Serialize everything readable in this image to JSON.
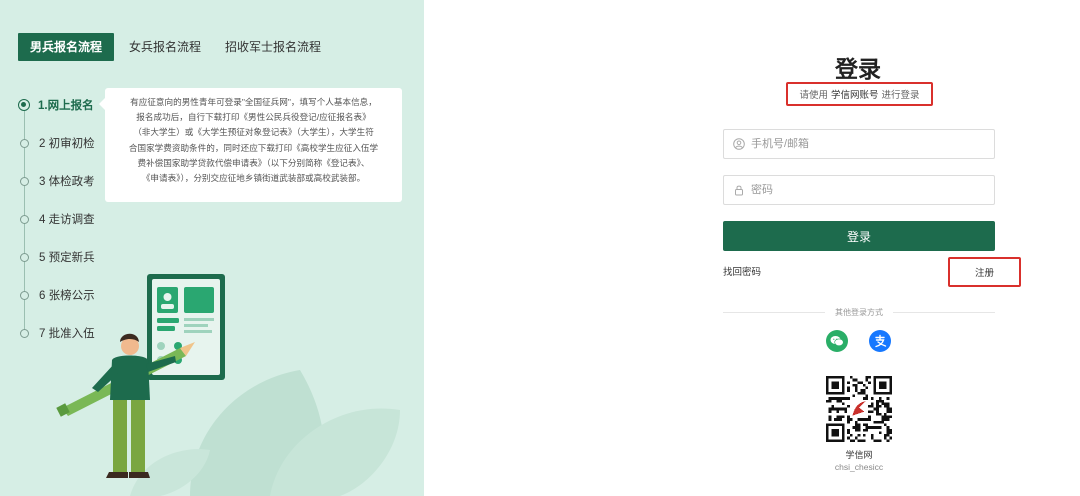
{
  "tabs": [
    {
      "label": "男兵报名流程",
      "active": true
    },
    {
      "label": "女兵报名流程",
      "active": false
    },
    {
      "label": "招收军士报名流程",
      "active": false
    }
  ],
  "steps": [
    {
      "label": "1.网上报名",
      "active": true
    },
    {
      "label": "2 初审初检",
      "active": false
    },
    {
      "label": "3 体检政考",
      "active": false
    },
    {
      "label": "4 走访调查",
      "active": false
    },
    {
      "label": "5 预定新兵",
      "active": false
    },
    {
      "label": "6 张榜公示",
      "active": false
    },
    {
      "label": "7 批准入伍",
      "active": false
    }
  ],
  "info": {
    "lines": [
      "有应征意向的男性青年可登录\"全国征兵网\"，填写个人基本信息，",
      "报名成功后，自行下载打印《男性公民兵役登记/应征报名表》",
      "（非大学生）或《大学生预征对象登记表》（大学生），大学生符",
      "合国家学费资助条件的，同时还应下载打印《高校学生应征入伍学",
      "费补偿国家助学贷款代偿申请表》（以下分别简称《登记表》、",
      "《申请表》），分别交应征地乡镇街道武装部或高校武装部。"
    ]
  },
  "login": {
    "title": "登录",
    "subtitle_prefix": "请使用",
    "subtitle_highlight": "学信网账号",
    "subtitle_suffix": "进行登录",
    "phone_placeholder": "手机号/邮箱",
    "password_placeholder": "密码",
    "login_button": "登录",
    "forgot_password": "找回密码",
    "register": "注册",
    "other_methods": "其他登录方式"
  },
  "qr": {
    "name": "学信网",
    "id": "chsi_chesicc"
  },
  "colors": {
    "primary": "#1d6b4d",
    "panel_bg": "#d6eee5",
    "highlight_border": "#d9302c",
    "wechat": "#2aae67",
    "alipay": "#1678ff"
  },
  "icons": [
    "user-icon",
    "lock-icon",
    "wechat-icon",
    "alipay-icon",
    "qr-code"
  ]
}
